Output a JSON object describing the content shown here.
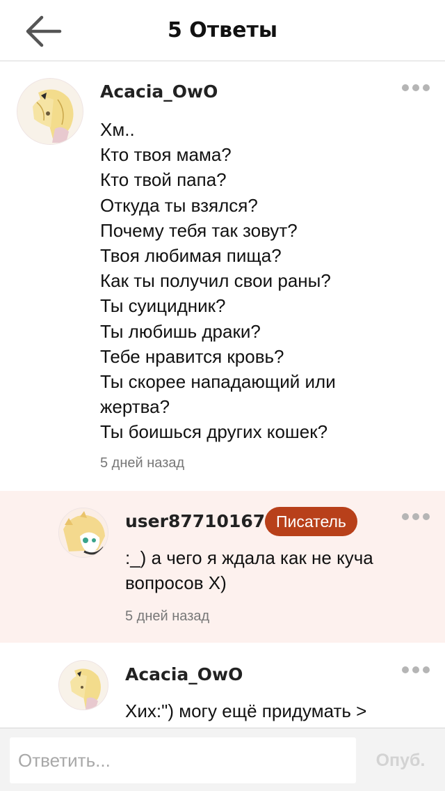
{
  "header": {
    "title": "5 Ответы",
    "back_icon": "arrow-left-icon"
  },
  "comments": [
    {
      "username": "Acacia_OwO",
      "text": "Хм..\nКто твоя мама?\nКто твой папа?\nОткуда ты взялся?\nПочему тебя так зовут?\nТвоя любимая пища?\nКак ты получил свои раны?\nТы суицидник?\nТы любишь  драки?\nТебе нравится кровь?\nТы скорее нападающий или\nжертва?\nТы боишься других кошек?",
      "timestamp": "5 дней назад",
      "more_icon": "more-dots-icon"
    },
    {
      "username": "user87710167",
      "badge": "Писатель",
      "badge_color": "#b8401a",
      "text": ":_) а чего я ждала как не куча\nвопросов Х)",
      "timestamp": "5 дней назад",
      "background": "#fdf1ee",
      "more_icon": "more-dots-icon"
    },
    {
      "username": "Acacia_OwO",
      "text": "Хих:\") могу ещё придумать >",
      "more_icon": "more-dots-icon"
    }
  ],
  "reply_bar": {
    "placeholder": "Ответить...",
    "publish_label": "Опуб."
  },
  "colors": {
    "accent": "#b8401a",
    "highlight_bg": "#fdf1ee",
    "muted_text": "#777777",
    "disabled_text": "#d3d3d3"
  }
}
